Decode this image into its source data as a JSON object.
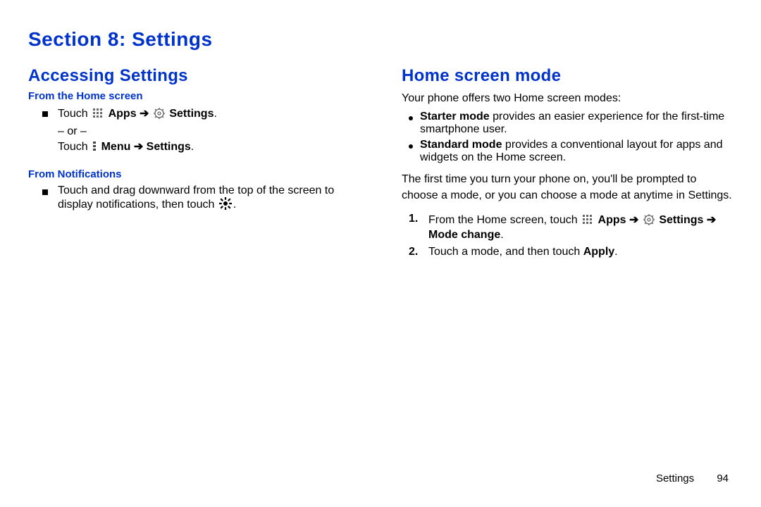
{
  "section_title": "Section 8: Settings",
  "left": {
    "h2": "Accessing Settings",
    "sub1": "From the Home screen",
    "line1_pre": "Touch ",
    "apps": "Apps",
    "arrow": "➔",
    "settings": "Settings",
    "period": ".",
    "or": "– or –",
    "line2_pre": "Touch ",
    "menu": "Menu ➔ Settings",
    "sub2": "From Notifications",
    "notif_text_a": "Touch and drag downward from the top of the screen to display notifications, then touch ",
    "notif_text_b": "."
  },
  "right": {
    "h2": "Home screen mode",
    "intro": "Your phone offers two Home screen modes:",
    "b1_label": "Starter mode",
    "b1_rest": " provides an easier experience for the first-time smartphone user.",
    "b2_label": "Standard mode",
    "b2_rest": " provides a conventional layout for apps and widgets on the Home screen.",
    "para2": "The first time you turn your phone on, you'll be prompted to choose a mode, or you can choose a mode at anytime in Settings.",
    "step1_pre": "From the Home screen, touch ",
    "step1_apps": "Apps",
    "step1_arrow1": "➔",
    "step1_settings": "Settings",
    "step1_arrow2": "➔ Mode change",
    "step1_period": ".",
    "step2_a": "Touch a mode, and then touch ",
    "step2_b": "Apply",
    "step2_c": "."
  },
  "footer": {
    "label": "Settings",
    "page": "94"
  }
}
